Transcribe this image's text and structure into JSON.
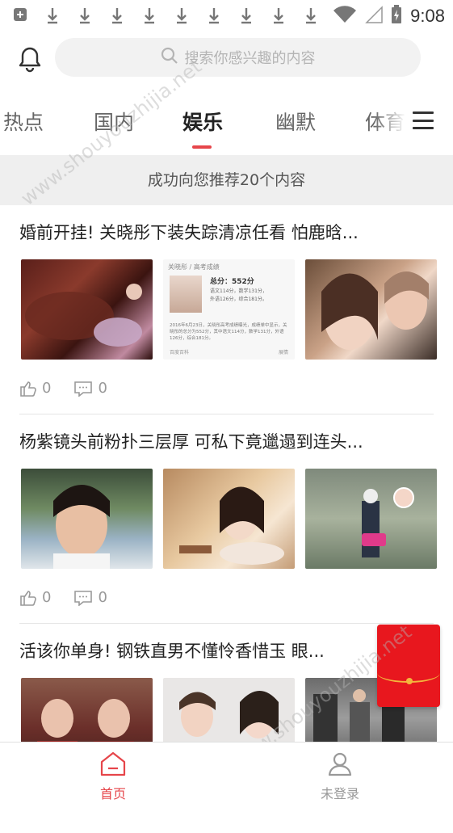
{
  "status_bar": {
    "time": "9:08",
    "notification_icons": [
      "add-box-icon",
      "download-icon",
      "download-icon",
      "download-icon",
      "download-icon",
      "download-icon",
      "download-icon",
      "download-icon",
      "download-icon",
      "download-icon"
    ],
    "wifi_icon": "wifi-icon",
    "signal_icon": "signal-icon",
    "battery_icon": "battery-charging-icon"
  },
  "header": {
    "bell_icon": "bell-icon",
    "search_placeholder": "搜索你感兴趣的内容"
  },
  "tabs": {
    "items": [
      "热点",
      "国内",
      "娱乐",
      "幽默",
      "体育"
    ],
    "active_index": 2,
    "menu_icon": "menu-icon"
  },
  "toast": {
    "text": "成功向您推荐20个内容"
  },
  "articles": [
    {
      "title": "婚前开挂! 关晓彤下装失踪清凉任看 怕鹿晗...",
      "likes": "0",
      "comments": "0",
      "image_overlay_texts": [
        "",
        "关晓彤 / 高考成绩",
        ""
      ],
      "score_card": {
        "total": "总分：552分",
        "chinese": "语文114分，数学131分，",
        "english": "外语126分，综合181分。",
        "desc": "2016年6月23日，关晓彤高考成绩曝光，成绩单中显示，关晓彤的总分为552分，其中语文114分，数学131分，外语126分，综合181分。",
        "footer_left": "百度百科",
        "footer_right": "展情"
      }
    },
    {
      "title": "杨紫镜头前粉扑三层厚 可私下竟邋遢到连头...",
      "likes": "0",
      "comments": "0"
    },
    {
      "title": "活该你单身! 钢铁直男不懂怜香惜玉 眼...",
      "likes": "",
      "comments": ""
    }
  ],
  "bottom_nav": {
    "home_label": "首页",
    "home_icon": "home-icon",
    "profile_label": "未登录",
    "profile_icon": "user-icon"
  },
  "colors": {
    "accent": "#e6454a",
    "red_packet": "#e8171e"
  },
  "watermark": "www.shouyouzhijia.net"
}
